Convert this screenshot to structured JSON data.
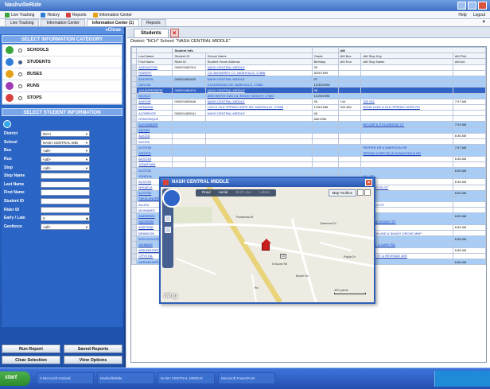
{
  "window": {
    "title": "NashvilleRide",
    "colors": {
      "titlebar": "#3f6fc4",
      "accent": "#2f6fd0"
    }
  },
  "menu": {
    "items": [
      {
        "label": "Live Tracking",
        "icon": "tracking-icon"
      },
      {
        "label": "History",
        "icon": "history-icon"
      },
      {
        "label": "Reports",
        "icon": "reports-icon"
      },
      {
        "label": "Information Center",
        "icon": "info-icon"
      }
    ],
    "help": "Help",
    "logout": "Logout"
  },
  "top_tabs": [
    {
      "label": "Live Tracking",
      "active": false
    },
    {
      "label": "Information Center",
      "active": false
    },
    {
      "label": "Information Center (1)",
      "active": true
    },
    {
      "label": "Reports",
      "active": false
    }
  ],
  "sidebar": {
    "close_label": "«Close",
    "category_heading": "SELECT INFORMATION CATEGORY",
    "categories": [
      {
        "label": "SCHOOLS",
        "icon": "school-icon",
        "color": "#3aa63a",
        "selected": false
      },
      {
        "label": "STUDENTS",
        "icon": "students-icon",
        "color": "#2f7fd8",
        "selected": true
      },
      {
        "label": "BUSES",
        "icon": "bus-icon",
        "color": "#e3a21a",
        "selected": false
      },
      {
        "label": "RUNS",
        "icon": "runs-icon",
        "color": "#a03bb8",
        "selected": false
      },
      {
        "label": "STOPS",
        "icon": "stops-icon",
        "color": "#d84040",
        "selected": false
      }
    ],
    "info_heading": "SELECT STUDENT INFORMATION",
    "fields": [
      {
        "label": "District",
        "value": "NCH",
        "dropdown": true
      },
      {
        "label": "School",
        "value": "NASH CENTRAL MID",
        "dropdown": true
      },
      {
        "label": "Bus",
        "value": "<all>",
        "dropdown": true
      },
      {
        "label": "Run",
        "value": "<all>",
        "dropdown": true
      },
      {
        "label": "Stop",
        "value": "<all>",
        "dropdown": true
      },
      {
        "label": "Stop Name",
        "value": "",
        "dropdown": false
      },
      {
        "label": "Last Name",
        "value": "",
        "dropdown": false
      },
      {
        "label": "First Name",
        "value": "",
        "dropdown": false
      },
      {
        "label": "Student ID",
        "value": "",
        "dropdown": false
      },
      {
        "label": "Rider ID",
        "value": "",
        "dropdown": false
      },
      {
        "label": "Early / Late",
        "value": "0",
        "dropdown": true
      },
      {
        "label": "Geofence",
        "value": "<all>",
        "dropdown": true
      }
    ],
    "buttons": {
      "run_report": "Run Report",
      "saved_reports": "Saved Reports",
      "clear_selection": "Clear Selection",
      "view_options": "View Options"
    }
  },
  "content": {
    "tab_label": "Students",
    "district_line": "District: \"NCH\" School: \"NASH CENTRAL MIDDLE\"",
    "group_headers": {
      "student_info": "Student Info",
      "am": "AM"
    },
    "columns": [
      "Last Name",
      "Student ID",
      "School Name",
      "Grade",
      "AM Bus",
      "AM Stop Key",
      "AM Pick"
    ],
    "columns_row2": [
      "First Name",
      "Rider ID",
      "Student Home Address",
      "Birthday",
      "AM Run",
      "AM Stop Name",
      "AM Act"
    ],
    "rows": [
      {
        "style": "white",
        "c": [
          "ADDINGTON",
          "000001662314",
          "NASH CENTRAL MIDDLE",
          "06",
          "",
          "",
          ""
        ]
      },
      {
        "style": "white",
        "c": [
          "ROBERT",
          "",
          "722 BAYBERRY CT, NASHVILLE, 27856",
          "8/29/1995",
          "",
          "",
          ""
        ]
      },
      {
        "style": "blue",
        "c": [
          "ADDISON",
          "000001662625",
          "NASH CENTRAL MIDDLE",
          "07",
          "",
          "",
          ""
        ]
      },
      {
        "style": "blue",
        "c": [
          "JAYLON",
          "",
          "3 DOGWOOD DR, NASHVILLE, 27856",
          "12/30/1996",
          "",
          "",
          ""
        ]
      },
      {
        "style": "hl",
        "c": [
          "AGUERREBERE",
          "000001450474",
          "NASH CENTRAL MIDDLE",
          "08",
          "",
          "",
          ""
        ]
      },
      {
        "style": "blue",
        "c": [
          "NICOLE",
          "",
          "8290 WHITE OAK LN, ROCKY MOUNT, 27803",
          "11/29/1995",
          "",
          "",
          ""
        ]
      },
      {
        "style": "white",
        "c": [
          "AHIYOR",
          "000001650648",
          "NASH CENTRAL MIDDLE",
          "06",
          "144",
          "320 001",
          "7:07 AM"
        ]
      },
      {
        "style": "white",
        "c": [
          "DEMARIA",
          "",
          "1220 E OLD SPRING HOPE RD, NASHVILLE, 27856",
          "1/26/1998",
          "320 662",
          "BONE LAKE & OLD SPRING HOPE RD",
          ""
        ]
      },
      {
        "style": "white",
        "c": [
          "ALDREDGE",
          "000001459041",
          "NASH CENTRAL MIDDLE",
          "06",
          "",
          "",
          ""
        ]
      },
      {
        "style": "white",
        "c": [
          "DOMONIQUE",
          "",
          "",
          "8/8/1996",
          "",
          "",
          ""
        ]
      },
      {
        "style": "blue",
        "c": [
          "ALEXANDER",
          "",
          "",
          "",
          "",
          "NR GAP & STILLBROOK CT",
          "7:03 AM"
        ]
      },
      {
        "style": "blue",
        "c": [
          "JAYDIN",
          "",
          "",
          "",
          "",
          "",
          ""
        ]
      },
      {
        "style": "white",
        "c": [
          "ALICEA",
          "",
          "",
          "",
          "",
          "",
          "6:36 AM"
        ]
      },
      {
        "style": "white",
        "c": [
          "ALEXIS",
          "",
          "",
          "",
          "",
          "",
          ""
        ]
      },
      {
        "style": "blue",
        "c": [
          "ALSTON",
          "",
          "",
          "",
          "",
          "PEPPER DR & EMERSON DR",
          "7:07 AM"
        ]
      },
      {
        "style": "blue",
        "c": [
          "JAYDEN",
          "",
          "",
          "",
          "",
          "SPRING HOPE RD & SUSAN FIELD RD",
          ""
        ]
      },
      {
        "style": "white",
        "c": [
          "ALSTON",
          "",
          "",
          "",
          "",
          "",
          "6:35 AM"
        ]
      },
      {
        "style": "white",
        "c": [
          "JONATHAN",
          "",
          "",
          "",
          "",
          "",
          ""
        ]
      },
      {
        "style": "blue",
        "c": [
          "ALSTON",
          "",
          "",
          "",
          "",
          "",
          "6:05 AM"
        ]
      },
      {
        "style": "blue",
        "c": [
          "JONELIA",
          "",
          "",
          "",
          "",
          "ALL ST",
          ""
        ]
      },
      {
        "style": "white",
        "c": [
          "ALSTON",
          "",
          "",
          "",
          "",
          "",
          "6:35 AM"
        ]
      },
      {
        "style": "white",
        "c": [
          "MIKAELA",
          "",
          "",
          "",
          "",
          "ST & ALSTON ST",
          ""
        ]
      },
      {
        "style": "blue",
        "c": [
          "ALSTON",
          "",
          "",
          "",
          "",
          "",
          "6:05 AM"
        ]
      },
      {
        "style": "blue",
        "c": [
          "TAKALANDRE",
          "",
          "",
          "",
          "",
          "",
          ""
        ]
      },
      {
        "style": "white",
        "c": [
          "ALLEN",
          "",
          "",
          "",
          "",
          "& BRANCH ST",
          ""
        ]
      },
      {
        "style": "white",
        "c": [
          "MOHAMED",
          "",
          "",
          "",
          "",
          "",
          ""
        ]
      },
      {
        "style": "blue",
        "c": [
          "ANDREWS",
          "",
          "",
          "",
          "",
          "",
          "6:05 AM"
        ]
      },
      {
        "style": "blue",
        "c": [
          "JACKSON",
          "",
          "",
          "",
          "",
          "NCH ST & DOWDY ST",
          ""
        ]
      },
      {
        "style": "white",
        "c": [
          "ANSTEAD",
          "",
          "",
          "",
          "",
          "",
          "6:52 AM"
        ]
      },
      {
        "style": "white",
        "c": [
          "BRANDON",
          "",
          "581 KINGSTON AVENUE, ROCKY MOUNT, 27803",
          "3/14/1997",
          "320 910",
          "KINGSTON AVE & SHADY GROVE MHP",
          ""
        ]
      },
      {
        "style": "blue",
        "c": [
          "APPLEWHITE",
          "000001865932",
          "NASH CENTRAL MIDDLE",
          "06",
          "300",
          "320 008",
          "6:35 AM"
        ]
      },
      {
        "style": "blue",
        "c": [
          "JAHMAIR",
          "",
          "2700 GARY RD, ROCKY MOUNT, 27803",
          "6/6/1999",
          "320 914",
          "HAGS ST & GARY RD",
          ""
        ]
      },
      {
        "style": "white",
        "c": [
          "ARRUMHOFE",
          "000001558520",
          "NASH CENTRAL MIDDLE",
          "06",
          "95",
          "320 003",
          "6:55 AM"
        ]
      },
      {
        "style": "white",
        "c": [
          "CRYSTAL",
          "",
          "829 FENDER ST, ROCKY MOUNT, 27801",
          "11/11/1995",
          "320 301",
          "FENDER ST & REVENUE AVE",
          ""
        ]
      },
      {
        "style": "blue",
        "c": [
          "ARRUMHOFE",
          "000001659408",
          "NASH CENTRAL MIDDLE",
          "06",
          "95",
          "320 003",
          "6:55 AM"
        ]
      }
    ]
  },
  "map_popup": {
    "title": "NASH CENTRAL MIDDLE",
    "view_modes": [
      "Road",
      "Aerial",
      "Bird's eye",
      "Labels"
    ],
    "toolbox_label": "Map Toolbox",
    "scale_label": "400 yards",
    "logo": "bing",
    "streets": [
      "Ponderosa Dr",
      "Claremont Dr",
      "N Boone Rd",
      "Boone Rd",
      "Rd",
      "Poplar Dr"
    ],
    "route_badge": "58"
  },
  "taskbar": {
    "start_label": "start",
    "items": [
      "3 Microsoft Outlook",
      "NashvilleRide",
      "NASH CENTRAL MIDDLE",
      "Microsoft PowerPoint"
    ]
  }
}
